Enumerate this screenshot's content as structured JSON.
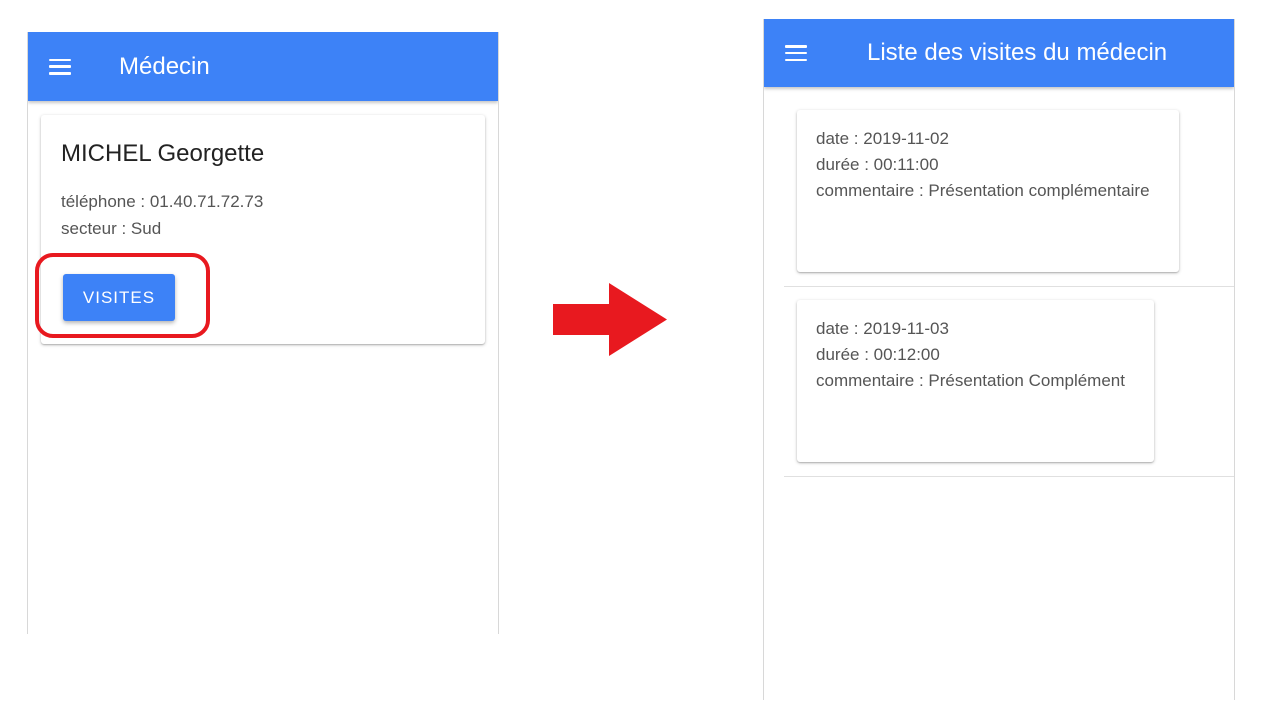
{
  "left_screen": {
    "toolbar": {
      "title": "Médecin",
      "menu_icon": "hamburger-menu-icon"
    },
    "doctor": {
      "name": "MICHEL Georgette",
      "phone": "téléphone : 01.40.71.72.73",
      "sector": "secteur : Sud"
    },
    "visits_button": {
      "label": "VISITES"
    }
  },
  "right_screen": {
    "toolbar": {
      "title": "Liste des visites du médecin",
      "menu_icon": "hamburger-menu-icon"
    },
    "visits": [
      {
        "date": "date : 2019-11-02",
        "duration": "durée : 00:11:00",
        "comment": "commentaire : Présentation complémentaire"
      },
      {
        "date": "date : 2019-11-03",
        "duration": "durée : 00:12:00",
        "comment": "commentaire : Présentation Complément"
      }
    ]
  },
  "colors": {
    "toolbar": "#3d82f7",
    "button": "#3d82f7",
    "highlight": "#e8191f",
    "arrow": "#e8191f"
  }
}
